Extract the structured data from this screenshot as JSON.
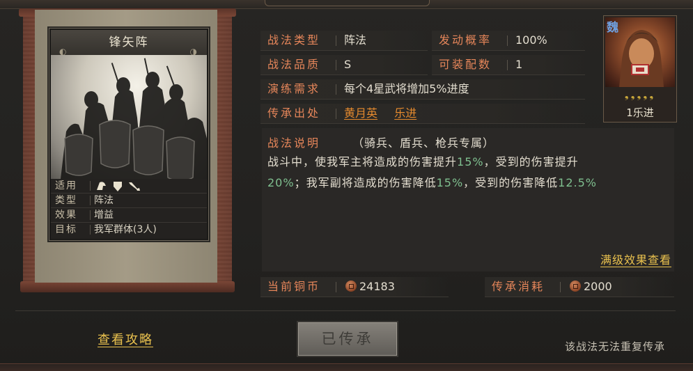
{
  "card": {
    "title": "锋矢阵",
    "info": [
      {
        "key": "适用",
        "value": ""
      },
      {
        "key": "类型",
        "value": "阵法"
      },
      {
        "key": "效果",
        "value": "增益"
      },
      {
        "key": "目标",
        "value": "我军群体(3人)"
      }
    ],
    "unit_icons": [
      "cavalry-icon",
      "shield-icon",
      "spear-icon"
    ]
  },
  "fields": {
    "type_label": "战法类型",
    "type_value": "阵法",
    "rate_label": "发动概率",
    "rate_value": "100%",
    "quality_label": "战法品质",
    "quality_value": "S",
    "slots_label": "可装配数",
    "slots_value": "1",
    "train_label": "演练需求",
    "train_value": "每个4星武将增加5%进度",
    "source_label": "传承出处",
    "source_1": "黄月英",
    "source_2": "乐进"
  },
  "description": {
    "label": "战法说明",
    "tag": "（骑兵、盾兵、枪兵专属）",
    "line1_a": "战斗中，使我军主将造成的伤害提升",
    "line1_b": "15%",
    "line1_c": "，受到的伤害提升",
    "line2_a": "20%",
    "line2_b": "；我军副将造成的伤害降低",
    "line2_c": "15%",
    "line2_d": "，受到的伤害降低",
    "line2_e": "12.5%",
    "more_link": "满级效果查看"
  },
  "costs": {
    "current_label": "当前铜币",
    "current_value": "24183",
    "inherit_label": "传承消耗",
    "inherit_value": "2000"
  },
  "portrait": {
    "faction": "魏",
    "stars": "❟❟❟❟❟",
    "name": "1乐进"
  },
  "footer": {
    "guide_link": "查看攻略",
    "button_label": "已传承",
    "note": "该战法无法重复传承"
  },
  "colors": {
    "accent_orange": "#e6865a",
    "link_orange": "#e58a2e",
    "highlight_green": "#7fbf8f",
    "link_gold": "#e9c14e"
  }
}
